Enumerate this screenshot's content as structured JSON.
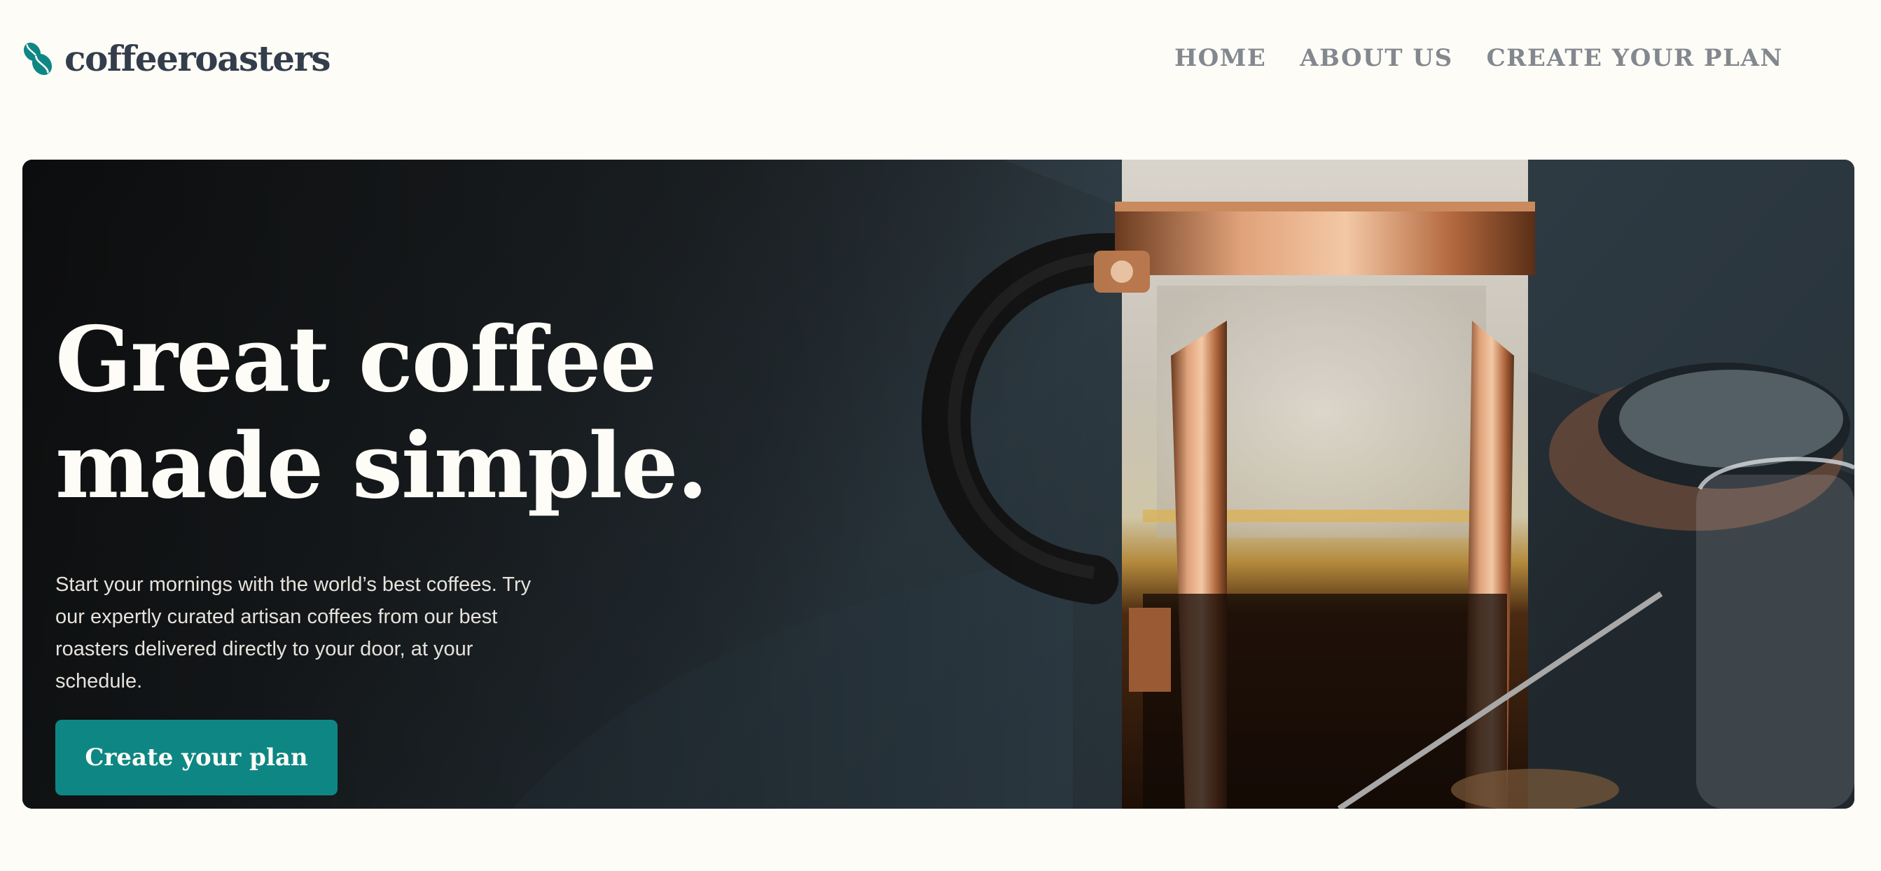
{
  "brand": {
    "name": "coffeeroasters",
    "logo_icon": "coffee-bean-icon",
    "colors": {
      "accent": "#0E8784",
      "dark": "#333D4B",
      "nav": "#83888F",
      "background": "#FEFCF7"
    }
  },
  "nav": {
    "items": [
      {
        "label": "HOME"
      },
      {
        "label": "ABOUT US"
      },
      {
        "label": "CREATE YOUR PLAN"
      }
    ]
  },
  "hero": {
    "title_line1": "Great coffee",
    "title_line2": "made simple.",
    "text": "Start your mornings with the world’s best coffees. Try our expertly curated artisan coffees from our best roasters delivered directly to your door, at your schedule.",
    "button_label": "Create your plan",
    "image": "french-press-coffee-photo"
  }
}
